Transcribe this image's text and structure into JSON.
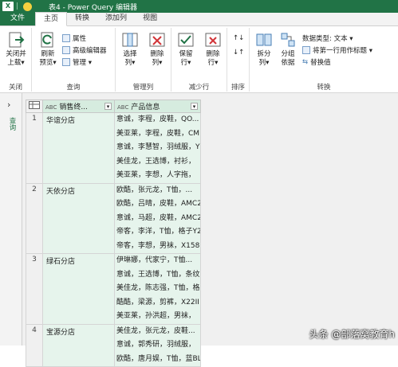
{
  "titlebar": {
    "app_icon": "X",
    "title": "表4 - Power Query 编辑器"
  },
  "tabs": [
    "文件",
    "主页",
    "转换",
    "添加列",
    "视图"
  ],
  "ribbon": {
    "groups": {
      "close": "关闭",
      "query": "查询",
      "manage_cols": "管理列",
      "reduce_rows": "减少行",
      "sort": "排序",
      "transform": "转换"
    },
    "buttons": {
      "close_load": "关闭并\n上载▾",
      "refresh": "刷新\n预览▾",
      "properties": "属性",
      "advanced_editor": "高级编辑器",
      "manage": "管理 ▾",
      "choose_cols": "选择\n列▾",
      "remove_cols": "删除\n列▾",
      "keep_rows": "保留\n行▾",
      "remove_rows": "删除\n行▾",
      "split_col": "拆分\n列▾",
      "group_by": "分组\n依据",
      "data_type": "数据类型: 文本 ▾",
      "first_row_header": "将第一行用作标题 ▾",
      "replace_values": "替换值"
    }
  },
  "sidebar": {
    "label": "查询"
  },
  "table": {
    "columns": [
      "销售终...",
      "产品信息"
    ],
    "col_type": "A\nBC",
    "rows": [
      {
        "num": "1",
        "store": "华谊分店",
        "info": [
          "意诚，李程，皮鞋，QO...",
          "美亚莱，李程，皮鞋，CM",
          "意诚，李慧智，羽绒服，Y",
          "美佳龙，王选博，衬衫，",
          "美亚莱，李想，人字拖，"
        ]
      },
      {
        "num": "2",
        "store": "天依分店",
        "info": [
          "欧酷，张元龙，T恤，...",
          "欧酷，吕晴，皮鞋，AMC2",
          "意诚，马超，皮鞋，AMC2",
          "帝客，李洋，T恤，格子Y2",
          "帝客，李想，男袜，X158"
        ]
      },
      {
        "num": "3",
        "store": "绿石分店",
        "info": [
          "伊琳娜，代家宁，T恤...",
          "意诚，王选博，T恤，条纹",
          "美佳龙，陈志强，T恤，格",
          "酷酷，梁源，剪裤，X22II",
          "美亚莱，孙洪超，男袜，"
        ]
      },
      {
        "num": "4",
        "store": "宝源分店",
        "info": [
          "美佳龙，张元龙，皮鞋...",
          "意诚，郭秀研，羽绒服，",
          "欧酷，唐月娱，T恤，蓝BL"
        ]
      }
    ]
  },
  "watermark": "头条 @部落窝教育h"
}
